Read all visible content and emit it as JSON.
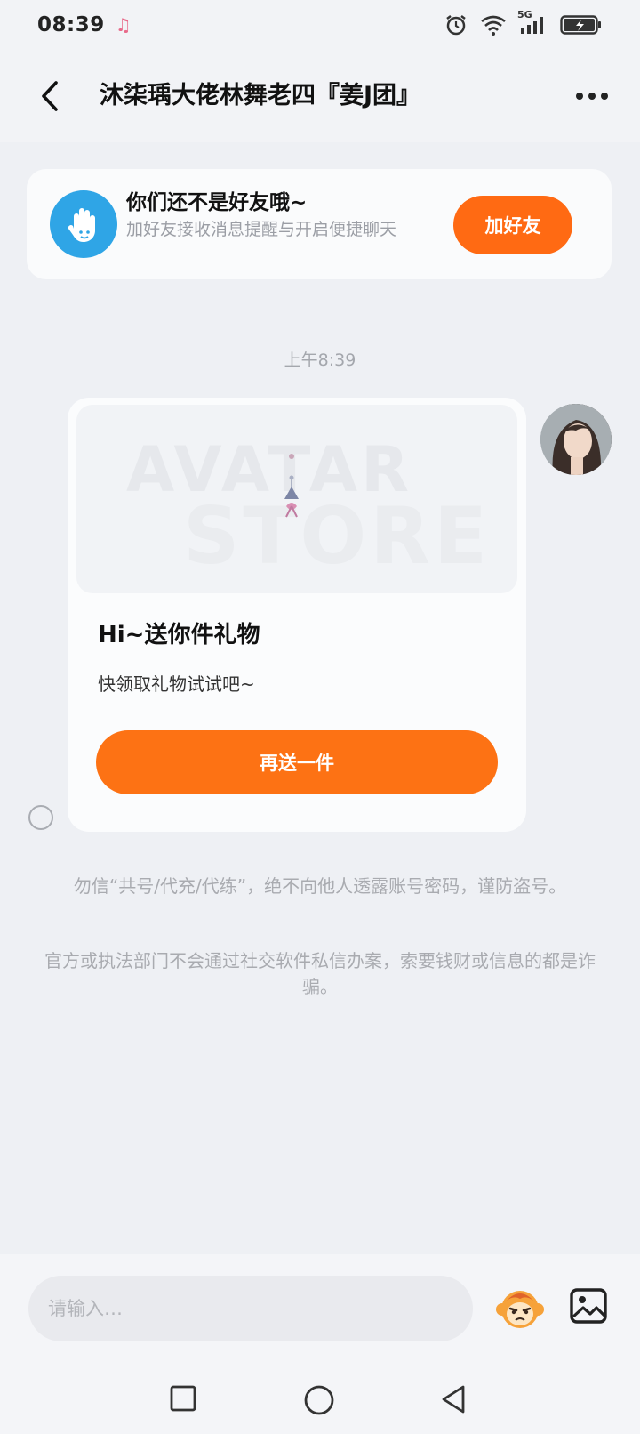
{
  "status_bar": {
    "time": "08:39",
    "network": "5G"
  },
  "header": {
    "title": "沐柒瑀大佬林舞老四『姜J团』"
  },
  "friend_banner": {
    "title": "你们还不是好友哦~",
    "subtitle": "加好友接收消息提醒与开启便捷聊天",
    "button_label": "加好友"
  },
  "chat": {
    "timestamp": "上午8:39",
    "gift_card": {
      "watermark_line1": "AVATAR",
      "watermark_line2": "STORE",
      "title": "Hi~送你件礼物",
      "subtitle": "快领取礼物试试吧~",
      "button_label": "再送一件"
    }
  },
  "warnings": [
    "勿信“共号/代充/代练”，绝不向他人透露账号密码，谨防盗号。",
    "官方或执法部门不会通过社交软件私信办案，索要钱财或信息的都是诈骗。"
  ],
  "input_bar": {
    "placeholder": "请输入…"
  },
  "colors": {
    "accent_orange": "#ff6a13",
    "friend_icon_blue": "#2fa5e6",
    "background": "#eef0f4"
  }
}
